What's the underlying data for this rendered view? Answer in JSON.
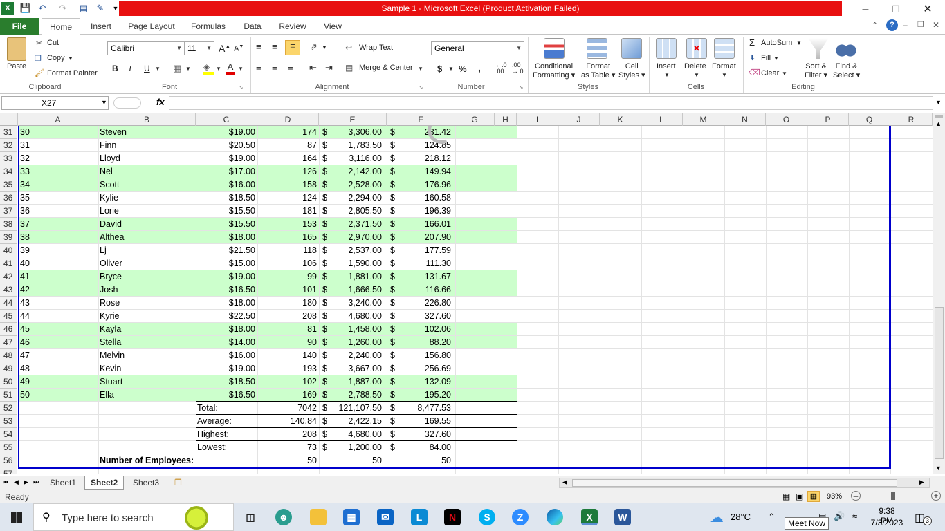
{
  "window": {
    "title": "Sample 1  -  Microsoft Excel (Product Activation Failed)",
    "accent": "#e81010"
  },
  "tabs": [
    "File",
    "Home",
    "Insert",
    "Page Layout",
    "Formulas",
    "Data",
    "Review",
    "View"
  ],
  "ribbon": {
    "clipboard": {
      "paste": "Paste",
      "cut": "Cut",
      "copy": "Copy",
      "format_painter": "Format Painter",
      "label": "Clipboard"
    },
    "font": {
      "name": "Calibri",
      "size": "11",
      "bold": "B",
      "italic": "I",
      "underline": "U",
      "label": "Font"
    },
    "alignment": {
      "wrap": "Wrap Text",
      "merge": "Merge & Center",
      "label": "Alignment"
    },
    "number": {
      "format": "General",
      "currency": "$",
      "percent": "%",
      "comma": ",",
      "label": "Number"
    },
    "styles": {
      "cond1": "Conditional",
      "cond2": "Formatting",
      "fmt1": "Format",
      "fmt2": "as Table",
      "cell1": "Cell",
      "cell2": "Styles",
      "label": "Styles"
    },
    "cells": {
      "insert": "Insert",
      "delete": "Delete",
      "format": "Format",
      "label": "Cells"
    },
    "editing": {
      "autosum": "AutoSum",
      "fill": "Fill",
      "clear": "Clear",
      "sort1": "Sort &",
      "sort2": "Filter",
      "find1": "Find &",
      "find2": "Select",
      "label": "Editing"
    }
  },
  "formula_bar": {
    "name_box": "X27",
    "fx": "fx",
    "value": ""
  },
  "columns": [
    "A",
    "B",
    "C",
    "D",
    "E",
    "F",
    "G",
    "H",
    "I",
    "J",
    "K",
    "L",
    "M",
    "N",
    "O",
    "P",
    "Q",
    "R"
  ],
  "rows": [
    {
      "n": "31",
      "a": "30",
      "b": "Steven",
      "c": "$19.00",
      "d": "174",
      "e": "3,306.00",
      "f": "231.42",
      "green": true
    },
    {
      "n": "32",
      "a": "31",
      "b": "Finn",
      "c": "$20.50",
      "d": "87",
      "e": "1,783.50",
      "f": "124.85",
      "green": false
    },
    {
      "n": "33",
      "a": "32",
      "b": "Lloyd",
      "c": "$19.00",
      "d": "164",
      "e": "3,116.00",
      "f": "218.12",
      "green": false
    },
    {
      "n": "34",
      "a": "33",
      "b": "Nel",
      "c": "$17.00",
      "d": "126",
      "e": "2,142.00",
      "f": "149.94",
      "green": true
    },
    {
      "n": "35",
      "a": "34",
      "b": "Scott",
      "c": "$16.00",
      "d": "158",
      "e": "2,528.00",
      "f": "176.96",
      "green": true
    },
    {
      "n": "36",
      "a": "35",
      "b": "Kylie",
      "c": "$18.50",
      "d": "124",
      "e": "2,294.00",
      "f": "160.58",
      "green": false
    },
    {
      "n": "37",
      "a": "36",
      "b": "Lorie",
      "c": "$15.50",
      "d": "181",
      "e": "2,805.50",
      "f": "196.39",
      "green": false
    },
    {
      "n": "38",
      "a": "37",
      "b": "David",
      "c": "$15.50",
      "d": "153",
      "e": "2,371.50",
      "f": "166.01",
      "green": true
    },
    {
      "n": "39",
      "a": "38",
      "b": "Althea",
      "c": "$18.00",
      "d": "165",
      "e": "2,970.00",
      "f": "207.90",
      "green": true
    },
    {
      "n": "40",
      "a": "39",
      "b": "Lj",
      "c": "$21.50",
      "d": "118",
      "e": "2,537.00",
      "f": "177.59",
      "green": false
    },
    {
      "n": "41",
      "a": "40",
      "b": "Oliver",
      "c": "$15.00",
      "d": "106",
      "e": "1,590.00",
      "f": "111.30",
      "green": false
    },
    {
      "n": "42",
      "a": "41",
      "b": "Bryce",
      "c": "$19.00",
      "d": "99",
      "e": "1,881.00",
      "f": "131.67",
      "green": true
    },
    {
      "n": "43",
      "a": "42",
      "b": "Josh",
      "c": "$16.50",
      "d": "101",
      "e": "1,666.50",
      "f": "116.66",
      "green": true
    },
    {
      "n": "44",
      "a": "43",
      "b": "Rose",
      "c": "$18.00",
      "d": "180",
      "e": "3,240.00",
      "f": "226.80",
      "green": false
    },
    {
      "n": "45",
      "a": "44",
      "b": "Kyrie",
      "c": "$22.50",
      "d": "208",
      "e": "4,680.00",
      "f": "327.60",
      "green": false
    },
    {
      "n": "46",
      "a": "45",
      "b": "Kayla",
      "c": "$18.00",
      "d": "81",
      "e": "1,458.00",
      "f": "102.06",
      "green": true
    },
    {
      "n": "47",
      "a": "46",
      "b": "Stella",
      "c": "$14.00",
      "d": "90",
      "e": "1,260.00",
      "f": "88.20",
      "green": true
    },
    {
      "n": "48",
      "a": "47",
      "b": "Melvin",
      "c": "$16.00",
      "d": "140",
      "e": "2,240.00",
      "f": "156.80",
      "green": false
    },
    {
      "n": "49",
      "a": "48",
      "b": "Kevin",
      "c": "$19.00",
      "d": "193",
      "e": "3,667.00",
      "f": "256.69",
      "green": false
    },
    {
      "n": "50",
      "a": "49",
      "b": "Stuart",
      "c": "$18.50",
      "d": "102",
      "e": "1,887.00",
      "f": "132.09",
      "green": true
    },
    {
      "n": "51",
      "a": "50",
      "b": "Ella",
      "c": "$16.50",
      "d": "169",
      "e": "2,788.50",
      "f": "195.20",
      "green": true
    }
  ],
  "summary": [
    {
      "n": "52",
      "label": "Total:",
      "d": "7042",
      "e": "121,107.50",
      "f": "8,477.53"
    },
    {
      "n": "53",
      "label": "Average:",
      "d": "140.84",
      "e": "2,422.15",
      "f": "169.55"
    },
    {
      "n": "54",
      "label": "Highest:",
      "d": "208",
      "e": "4,680.00",
      "f": "327.60"
    },
    {
      "n": "55",
      "label": "Lowest:",
      "d": "73",
      "e": "1,200.00",
      "f": "84.00"
    }
  ],
  "employees_row": {
    "n": "56",
    "label": "Number of Employees:",
    "d": "50",
    "e": "50",
    "f": "50"
  },
  "dollar": "$",
  "row57": "57",
  "sheets": [
    "Sheet1",
    "Sheet2",
    "Sheet3"
  ],
  "active_sheet": "Sheet2",
  "status": {
    "ready": "Ready",
    "zoom": "93%"
  },
  "taskbar": {
    "search_placeholder": "Type here to search",
    "weather": "28°C",
    "time": "9:38 PM",
    "date": "7/3/2023",
    "meet_now": "Meet Now",
    "notif_count": "3"
  },
  "colors": {
    "row_green": "#ccffcc",
    "file_tab": "#2a7d2d",
    "border_blue": "#0000cc"
  }
}
